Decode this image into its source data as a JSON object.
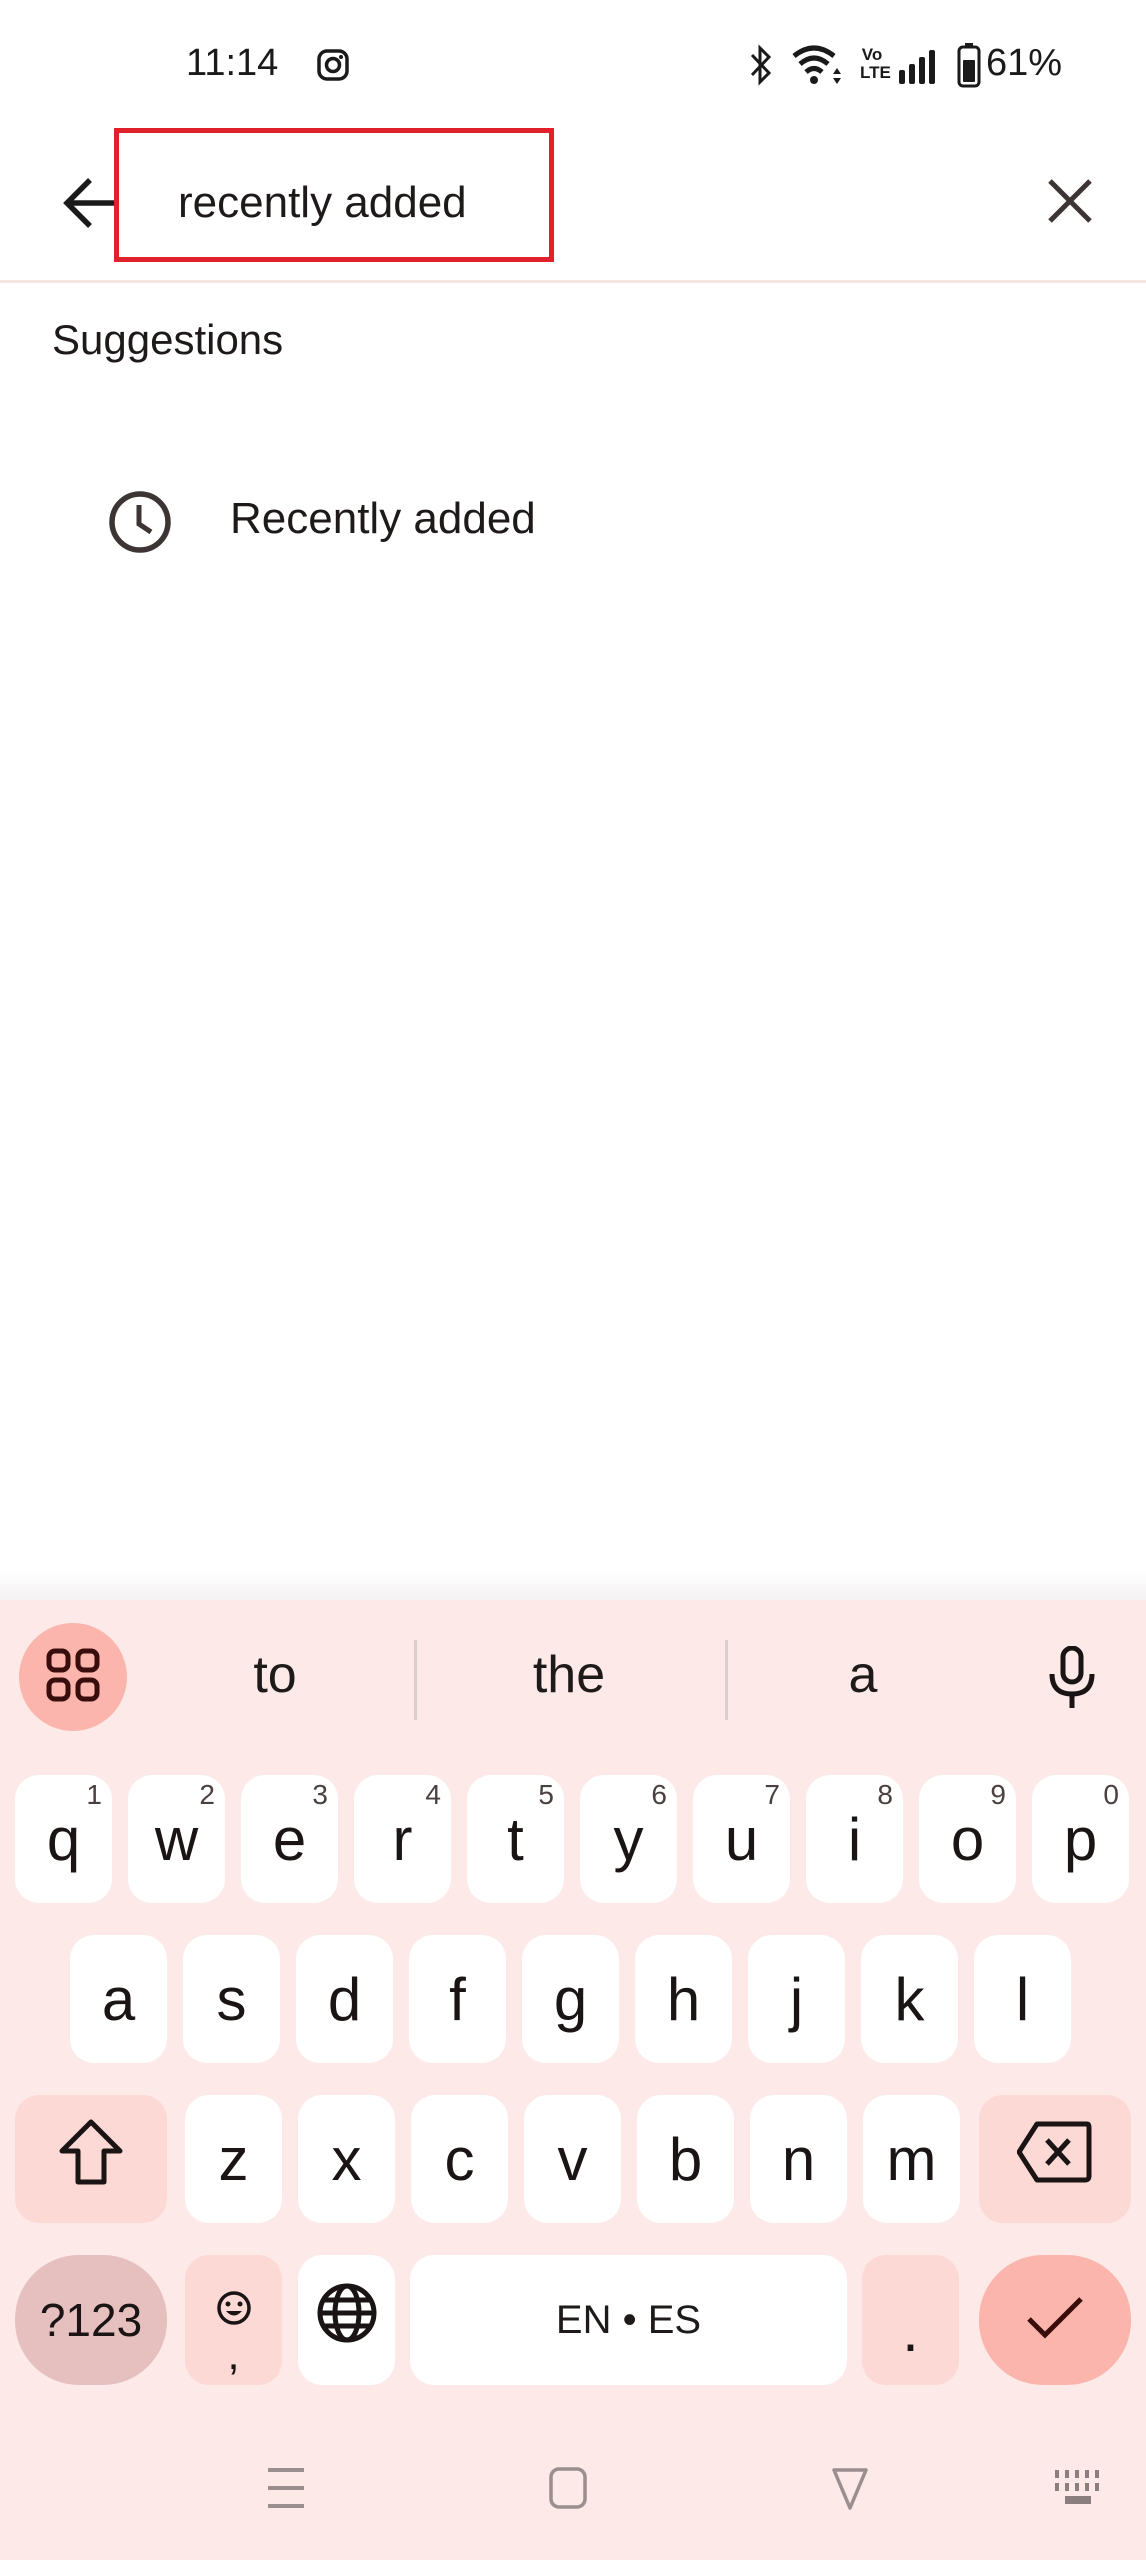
{
  "status_bar": {
    "time": "11:14",
    "notification_icons": [
      "instagram-icon"
    ],
    "system_icons": [
      "bluetooth-icon",
      "wifi-icon",
      "volte-icon",
      "signal-icon",
      "battery-icon"
    ],
    "volte_label_top": "Vo",
    "volte_label_bottom": "LTE",
    "battery_percent": "61%"
  },
  "search": {
    "query": "recently added",
    "back_icon": "arrow-left-icon",
    "clear_icon": "close-icon",
    "highlight_color": "#e0202b"
  },
  "suggestions": {
    "title": "Suggestions",
    "items": [
      {
        "icon": "history-clock-icon",
        "label": "Recently added"
      }
    ]
  },
  "keyboard": {
    "candidates": [
      "to",
      "the",
      "a"
    ],
    "rows": [
      [
        {
          "k": "q",
          "h": "1"
        },
        {
          "k": "w",
          "h": "2"
        },
        {
          "k": "e",
          "h": "3"
        },
        {
          "k": "r",
          "h": "4"
        },
        {
          "k": "t",
          "h": "5"
        },
        {
          "k": "y",
          "h": "6"
        },
        {
          "k": "u",
          "h": "7"
        },
        {
          "k": "i",
          "h": "8"
        },
        {
          "k": "o",
          "h": "9"
        },
        {
          "k": "p",
          "h": "0"
        }
      ],
      [
        {
          "k": "a"
        },
        {
          "k": "s"
        },
        {
          "k": "d"
        },
        {
          "k": "f"
        },
        {
          "k": "g"
        },
        {
          "k": "h"
        },
        {
          "k": "j"
        },
        {
          "k": "k"
        },
        {
          "k": "l"
        }
      ],
      [
        {
          "k": "z"
        },
        {
          "k": "x"
        },
        {
          "k": "c"
        },
        {
          "k": "v"
        },
        {
          "k": "b"
        },
        {
          "k": "n"
        },
        {
          "k": "m"
        }
      ]
    ],
    "symbols_label": "?123",
    "comma_label": ",",
    "space_label": "EN • ES",
    "period_label": ".",
    "accent_color": "#fbb5ad",
    "background_color": "#fce9e8"
  },
  "nav_bar": {
    "items": [
      "recents-icon",
      "home-icon",
      "back-icon",
      "keyboard-switch-icon"
    ]
  }
}
